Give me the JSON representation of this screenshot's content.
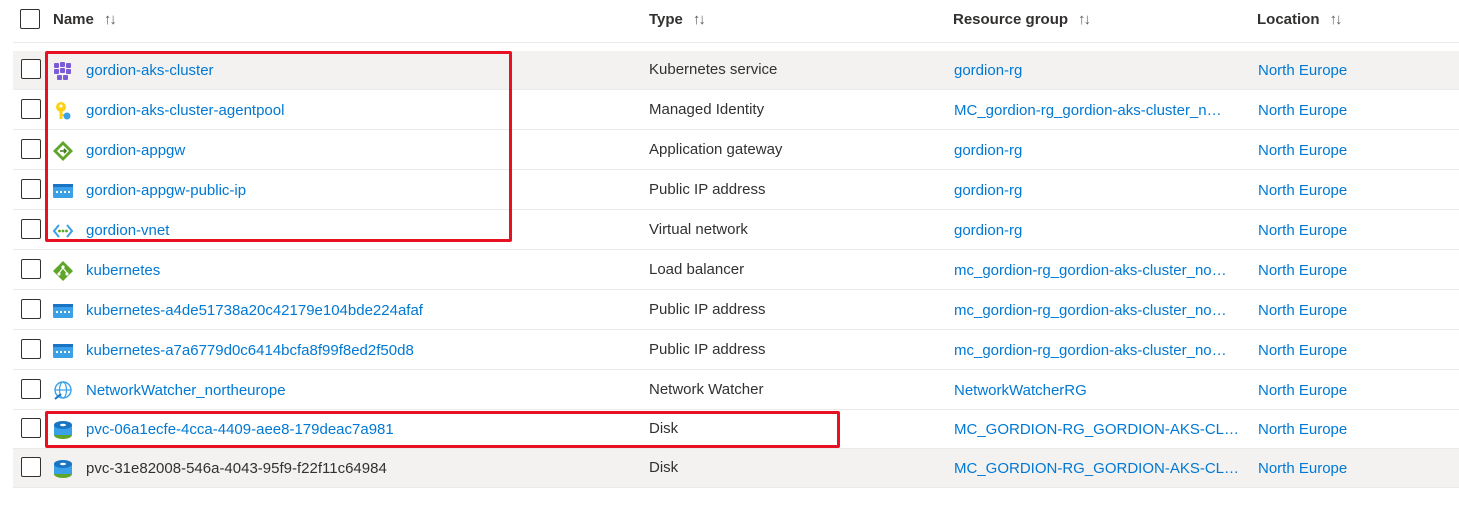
{
  "header": {
    "name": "Name",
    "type": "Type",
    "resource_group": "Resource group",
    "location": "Location",
    "sort_glyph": "↑↓"
  },
  "rows": [
    {
      "name": "gordion-aks-cluster",
      "icon": "kubernetes-service-icon",
      "type": "Kubernetes service",
      "rg": "gordion-rg",
      "loc": "North Europe"
    },
    {
      "name": "gordion-aks-cluster-agentpool",
      "icon": "managed-identity-icon",
      "type": "Managed Identity",
      "rg": "MC_gordion-rg_gordion-aks-cluster_n…",
      "loc": "North Europe"
    },
    {
      "name": "gordion-appgw",
      "icon": "application-gateway-icon",
      "type": "Application gateway",
      "rg": "gordion-rg",
      "loc": "North Europe"
    },
    {
      "name": "gordion-appgw-public-ip",
      "icon": "public-ip-icon",
      "type": "Public IP address",
      "rg": "gordion-rg",
      "loc": "North Europe"
    },
    {
      "name": "gordion-vnet",
      "icon": "virtual-network-icon",
      "type": "Virtual network",
      "rg": "gordion-rg",
      "loc": "North Europe"
    },
    {
      "name": "kubernetes",
      "icon": "load-balancer-icon",
      "type": "Load balancer",
      "rg": "mc_gordion-rg_gordion-aks-cluster_no…",
      "loc": "North Europe"
    },
    {
      "name": "kubernetes-a4de51738a20c42179e104bde224afaf",
      "icon": "public-ip-icon",
      "type": "Public IP address",
      "rg": "mc_gordion-rg_gordion-aks-cluster_no…",
      "loc": "North Europe"
    },
    {
      "name": "kubernetes-a7a6779d0c6414bcfa8f99f8ed2f50d8",
      "icon": "public-ip-icon",
      "type": "Public IP address",
      "rg": "mc_gordion-rg_gordion-aks-cluster_no…",
      "loc": "North Europe"
    },
    {
      "name": "NetworkWatcher_northeurope",
      "icon": "network-watcher-icon",
      "type": "Network Watcher",
      "rg": "NetworkWatcherRG",
      "loc": "North Europe"
    },
    {
      "name": "pvc-06a1ecfe-4cca-4409-aee8-179deac7a981",
      "icon": "disk-icon",
      "type": "Disk",
      "rg": "MC_GORDION-RG_GORDION-AKS-CL…",
      "loc": "North Europe"
    },
    {
      "name": "pvc-31e82008-546a-4043-95f9-f22f11c64984",
      "icon": "disk-icon",
      "type": "Disk",
      "rg": "MC_GORDION-RG_GORDION-AKS-CL…",
      "loc": "North Europe"
    }
  ],
  "colors": {
    "link": "#0078d4",
    "highlight_row": "#f3f2f1",
    "annotation_box": "#e81123"
  }
}
